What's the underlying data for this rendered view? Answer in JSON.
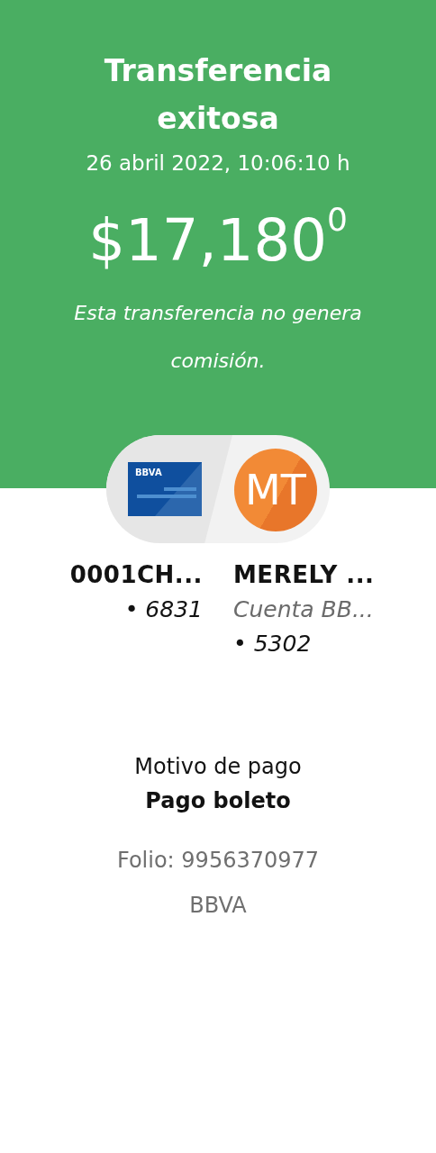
{
  "header": {
    "title": "Transferencia exitosa",
    "datetime": "26 abril 2022, 10:06:10 h",
    "amount": "$17,180$^{0}$",
    "note": "Esta transferencia no genera comisión."
  },
  "origin": {
    "card_logo": "BBVA",
    "name": "0001CH...",
    "account": "• 6831"
  },
  "destination": {
    "initials": "MT",
    "name": "MERELY ...",
    "account_type": "Cuenta BB...",
    "account": "• 5302"
  },
  "details": {
    "reason_label": "Motivo de pago",
    "reason": "Pago boleto",
    "folio": "Folio: 9956370977",
    "bank": "BBVA"
  }
}
